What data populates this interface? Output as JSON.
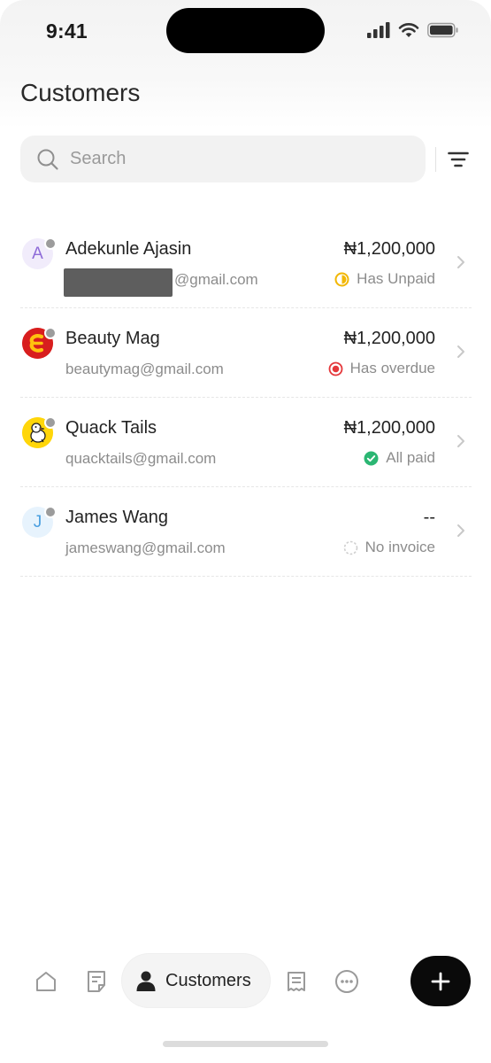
{
  "status_bar": {
    "time": "9:41"
  },
  "header": {
    "title": "Customers"
  },
  "search": {
    "placeholder": "Search"
  },
  "customers": [
    {
      "initial": "A",
      "name": "Adekunle Ajasin",
      "email": "@gmail.com",
      "amount": "₦1,200,000",
      "status": "Has Unpaid",
      "status_color": "#f2b705",
      "avatar_bg": "#f1ecfb",
      "avatar_fg": "#8e6bd8"
    },
    {
      "initial": "",
      "name": "Beauty Mag",
      "email": "beautymag@gmail.com",
      "amount": "₦1,200,000",
      "status": "Has overdue",
      "status_color": "#e5383b"
    },
    {
      "initial": "",
      "name": "Quack Tails",
      "email": "quacktails@gmail.com",
      "amount": "₦1,200,000",
      "status": "All paid",
      "status_color": "#2bb673"
    },
    {
      "initial": "J",
      "name": "James Wang",
      "email": "jameswang@gmail.com",
      "amount": "--",
      "status": "No invoice",
      "status_color": "#cfcfcf",
      "avatar_bg": "#e7f3fd",
      "avatar_fg": "#4a9fe0"
    }
  ],
  "bottom_nav": {
    "active_label": "Customers",
    "items": [
      "home-icon",
      "invoice-icon",
      "customers-icon",
      "receipt-icon",
      "more-icon"
    ]
  },
  "colors": {
    "accent": "#0a0a0a"
  }
}
